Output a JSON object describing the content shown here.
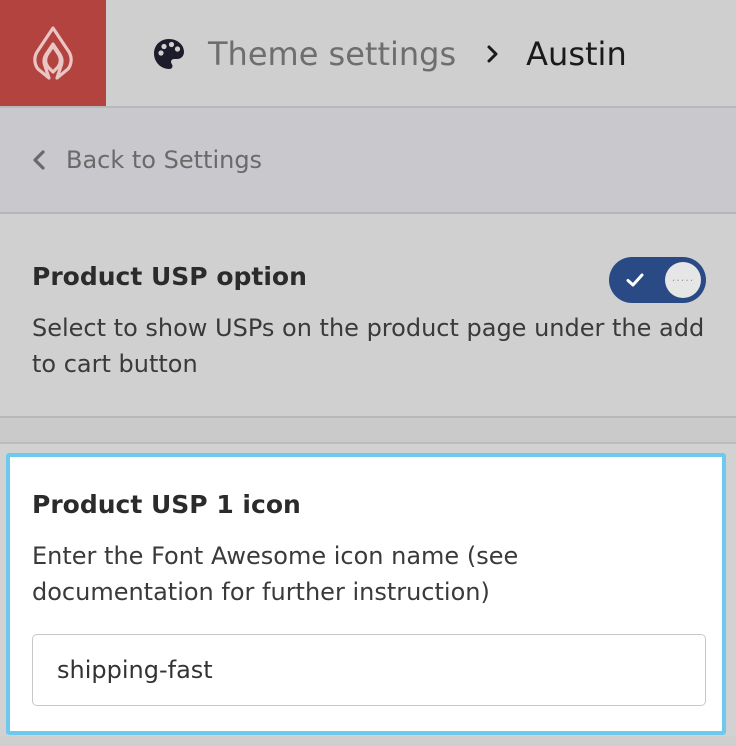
{
  "header": {
    "brand_icon": "lightspeed-flame-icon",
    "section_icon": "palette-icon",
    "breadcrumb_parent": "Theme settings",
    "breadcrumb_separator_icon": "chevron-right-icon",
    "breadcrumb_current": "Austin"
  },
  "back_nav": {
    "icon": "chevron-left-icon",
    "label": "Back to Settings"
  },
  "usp_option": {
    "heading": "Product USP option",
    "description": "Select to show USPs on the product page under the add to cart button",
    "toggle_on": true,
    "toggle_icon": "checkmark-icon"
  },
  "usp_icon_setting": {
    "heading": "Product USP 1 icon",
    "description": "Enter the Font Awesome icon name (see documentation for further instruction)",
    "value": "shipping-fast"
  },
  "colors": {
    "brand": "#b3433f",
    "toggle_on": "#2a4a85",
    "focus_outline": "#6ec9ee"
  }
}
